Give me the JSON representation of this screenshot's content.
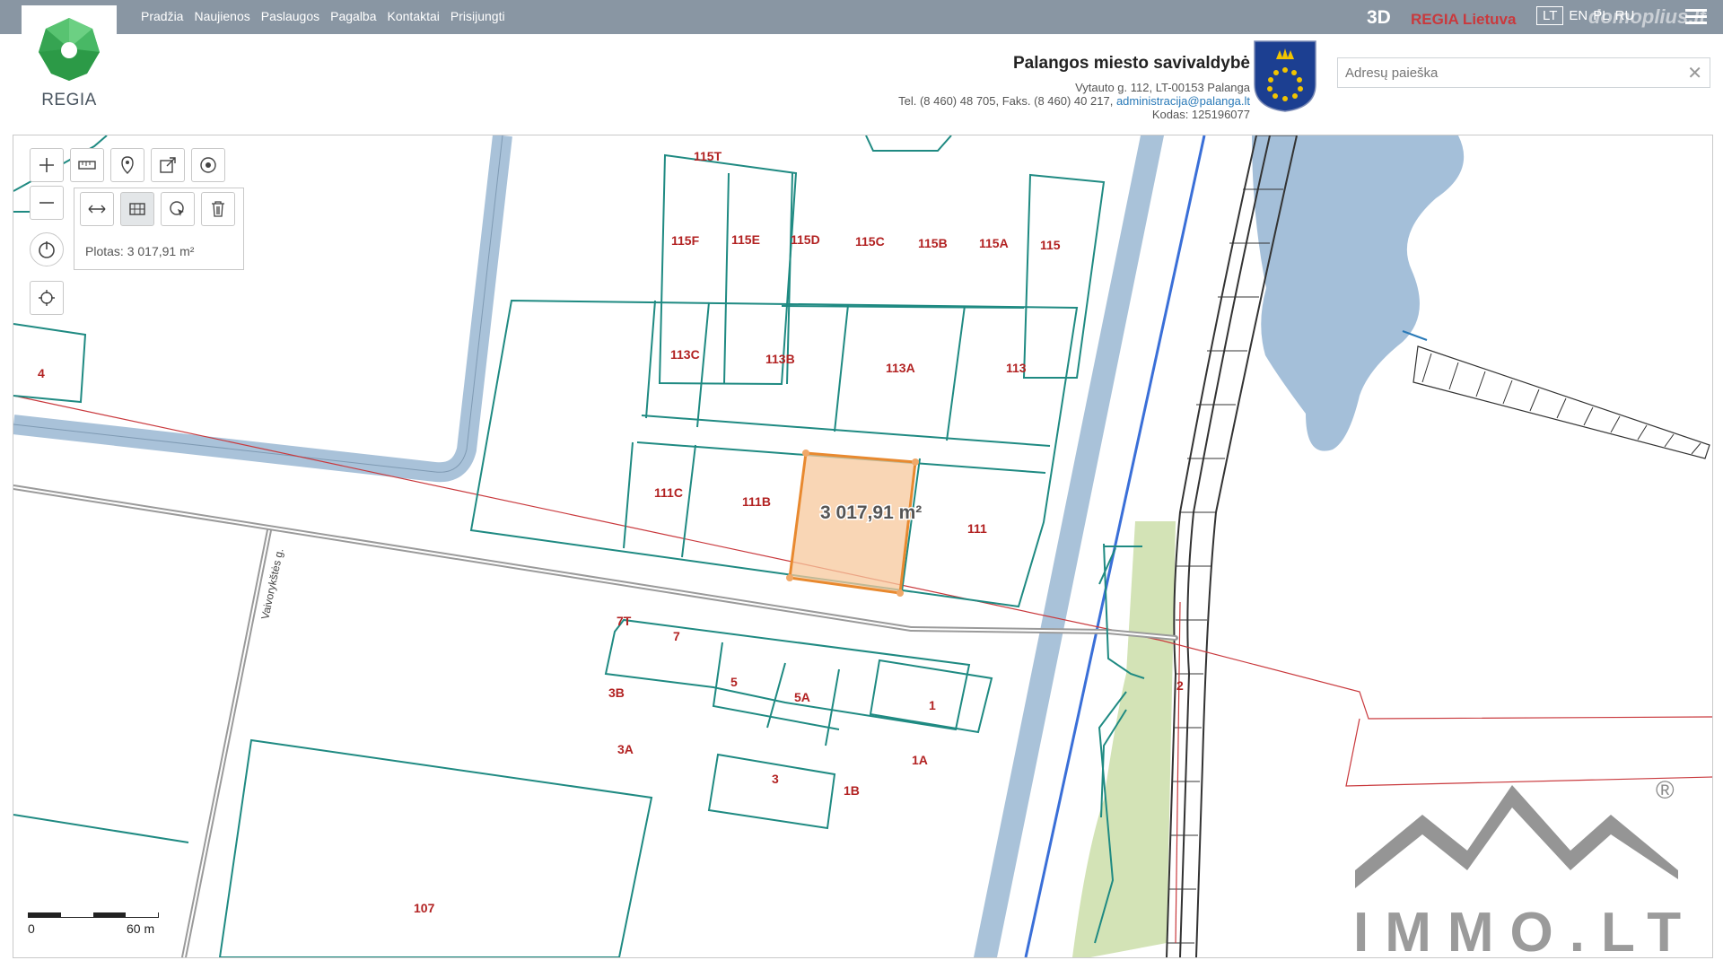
{
  "app": {
    "name": "REGIA"
  },
  "nav": {
    "items": [
      "Pradžia",
      "Naujienos",
      "Paslaugos",
      "Pagalba",
      "Kontaktai",
      "Prisijungti"
    ]
  },
  "topbar": {
    "btn_3d": "3D",
    "regia_lietuva": "REGIA Lietuva",
    "lang_lt": "LT",
    "lang_en": "EN",
    "lang_pl": "PL",
    "lang_ru": "RU",
    "watermark": "domoplius.lt"
  },
  "municipality": {
    "title": "Palangos miesto savivaldybė",
    "address": "Vytauto g. 112, LT-00153 Palanga",
    "phone": "Tel. (8 460) 48 705, Faks. (8 460) 40 217,",
    "email": "administracija@palanga.lt",
    "code": "Kodas: 125196077"
  },
  "search": {
    "placeholder": "Adresų paieška",
    "clear_icon": "close-icon"
  },
  "map": {
    "area_readout": "Plotas: 3 017,91 m²",
    "selected_area_label": "3 017,91 m²",
    "street_name": "Vaivorykštės g.",
    "scale": {
      "start": "0",
      "end": "60 m"
    },
    "parcels": [
      "115T",
      "115F",
      "115E",
      "115D",
      "115C",
      "115B",
      "115A",
      "115",
      "113C",
      "113B",
      "113A",
      "113",
      "111C",
      "111B",
      "111",
      "7T",
      "7",
      "3B",
      "5",
      "5A",
      "1",
      "3A",
      "1A",
      "3",
      "1B",
      "107",
      "4",
      "2"
    ],
    "colors": {
      "parcel_outline": "#1f8a82",
      "selection_fill": "#f7c89c",
      "selection_stroke": "#e8892f",
      "road": "#a9c2d9",
      "water": "#a4bfd9",
      "power_line": "#c9393d",
      "label": "#b22222"
    }
  },
  "brand_watermark": {
    "text": "IMMO.LT",
    "mark": "®"
  }
}
